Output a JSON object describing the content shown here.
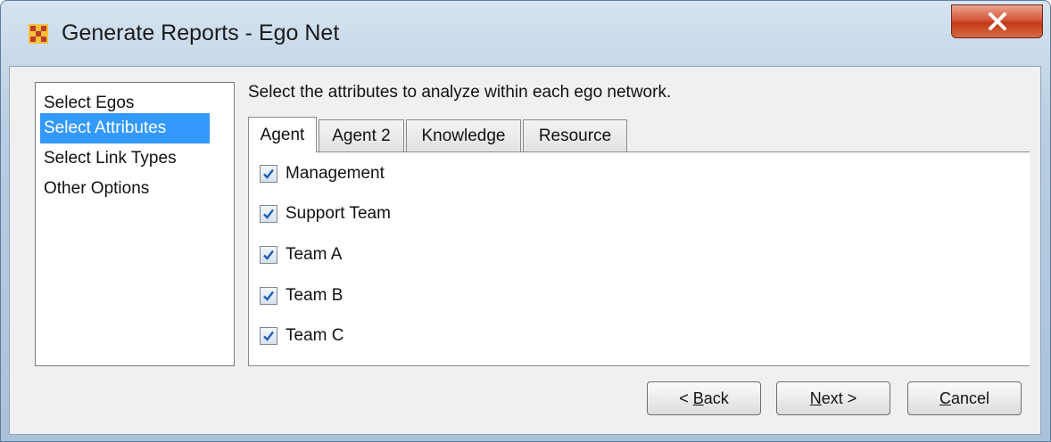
{
  "window": {
    "title": "Generate Reports - Ego Net",
    "app_icon": "ora-network-icon",
    "close_icon": "close-x-icon"
  },
  "sidebar": {
    "items": [
      {
        "label": "Select Egos",
        "selected": false
      },
      {
        "label": "Select Attributes",
        "selected": true
      },
      {
        "label": "Select Link Types",
        "selected": false
      },
      {
        "label": "Other Options",
        "selected": false
      }
    ]
  },
  "main": {
    "instruction": "Select the attributes to analyze within each ego network.",
    "tabs": [
      {
        "label": "Agent",
        "active": true
      },
      {
        "label": "Agent 2",
        "active": false
      },
      {
        "label": "Knowledge",
        "active": false
      },
      {
        "label": "Resource",
        "active": false
      }
    ],
    "attributes": [
      {
        "label": "Management",
        "checked": true
      },
      {
        "label": "Support Team",
        "checked": true
      },
      {
        "label": "Team A",
        "checked": true
      },
      {
        "label": "Team B",
        "checked": true
      },
      {
        "label": "Team C",
        "checked": true
      }
    ]
  },
  "buttons": {
    "back": {
      "prefix": "< ",
      "mnemonic": "B",
      "rest": "ack"
    },
    "next": {
      "mnemonic": "N",
      "rest": "ext >"
    },
    "cancel": {
      "mnemonic": "C",
      "rest": "ancel"
    }
  },
  "colors": {
    "selection": "#3399ff",
    "checkmark": "#1f5fb8",
    "close_button": "#c7432a"
  }
}
